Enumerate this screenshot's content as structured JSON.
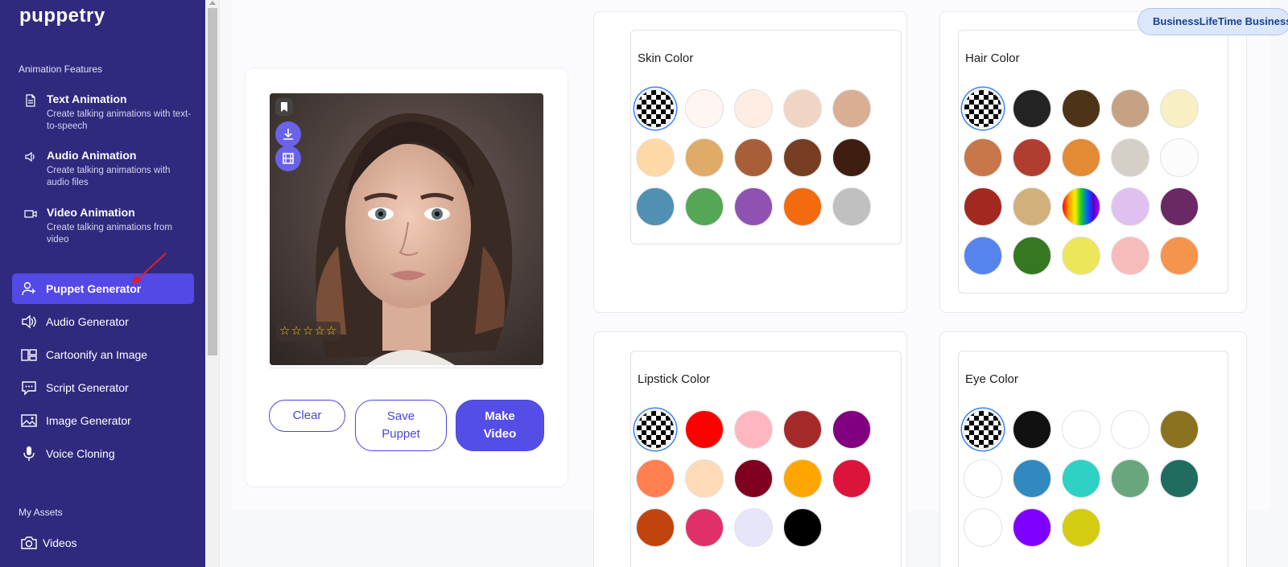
{
  "app": {
    "logo": "puppetry"
  },
  "sidebar": {
    "features_label": "Animation Features",
    "features": [
      {
        "title": "Text Animation",
        "desc": "Create talking animations with text-to-speech",
        "icon": "document-icon"
      },
      {
        "title": "Audio Animation",
        "desc": "Create talking animations with audio files",
        "icon": "speaker-icon"
      },
      {
        "title": "Video Animation",
        "desc": "Create talking animations from video",
        "icon": "video-camera-icon"
      }
    ],
    "nav": [
      {
        "label": "Puppet Generator",
        "icon": "user-plus-icon",
        "active": true
      },
      {
        "label": "Audio Generator",
        "icon": "speaker-icon"
      },
      {
        "label": "Cartoonify an Image",
        "icon": "cartoonify-icon"
      },
      {
        "label": "Script Generator",
        "icon": "chat-bubble-icon"
      },
      {
        "label": "Image Generator",
        "icon": "image-icon"
      },
      {
        "label": "Voice Cloning",
        "icon": "microphone-icon"
      }
    ],
    "assets_label": "My Assets",
    "assets": [
      {
        "label": "Videos",
        "icon": "camera-icon"
      }
    ]
  },
  "badge": "BusinessLifeTime Business",
  "preview": {
    "rating": "☆☆☆☆☆",
    "buttons": {
      "clear": "Clear",
      "save": "Save Puppet",
      "make": "Make Video"
    }
  },
  "panels": {
    "skin": {
      "title": "Skin Color",
      "swatches": [
        "transparent",
        "#fff5f3",
        "#fdede3",
        "#f0d5c4",
        "#d9ae95",
        "#ffd8a8",
        "#e0aa68",
        "#a95e3a",
        "#773d22",
        "#3e1e10",
        "#4f90b3",
        "#54a855",
        "#8f52b1",
        "#f26b0e",
        "#c0c0c0"
      ]
    },
    "hair": {
      "title": "Hair Color",
      "swatches": [
        "transparent",
        "#232323",
        "#4d3318",
        "#c4a283",
        "#f8efc2",
        "#c7774a",
        "#b03e30",
        "#e38b34",
        "#d4d0c8",
        "#fdfcfc",
        "#a3281f",
        "#d2b07b",
        "rainbow",
        "#dfc0ee",
        "#6a2865",
        "#5683ec",
        "#357821",
        "#ece65a",
        "#f6bcbc",
        "#f5944d"
      ]
    },
    "lipstick": {
      "title": "Lipstick Color",
      "swatches": [
        "transparent",
        "#ff0000",
        "#ffb6c1",
        "#a52a2a",
        "#800080",
        "#ff7f50",
        "#ffdab9",
        "#800020",
        "#ffa500",
        "#dc143c",
        "#c1440e",
        "#e0306a",
        "#e6e6fa",
        "#000000"
      ]
    },
    "eye": {
      "title": "Eye Color",
      "swatches": [
        "transparent",
        "#111111",
        "#ffffff",
        "#ffffff",
        "#8b7220",
        "#ffffff",
        "#3189c0",
        "#2ed1c3",
        "#6aa67c",
        "#206c5f",
        "#ffffff",
        "#8000ff",
        "#d4cc10"
      ]
    }
  }
}
